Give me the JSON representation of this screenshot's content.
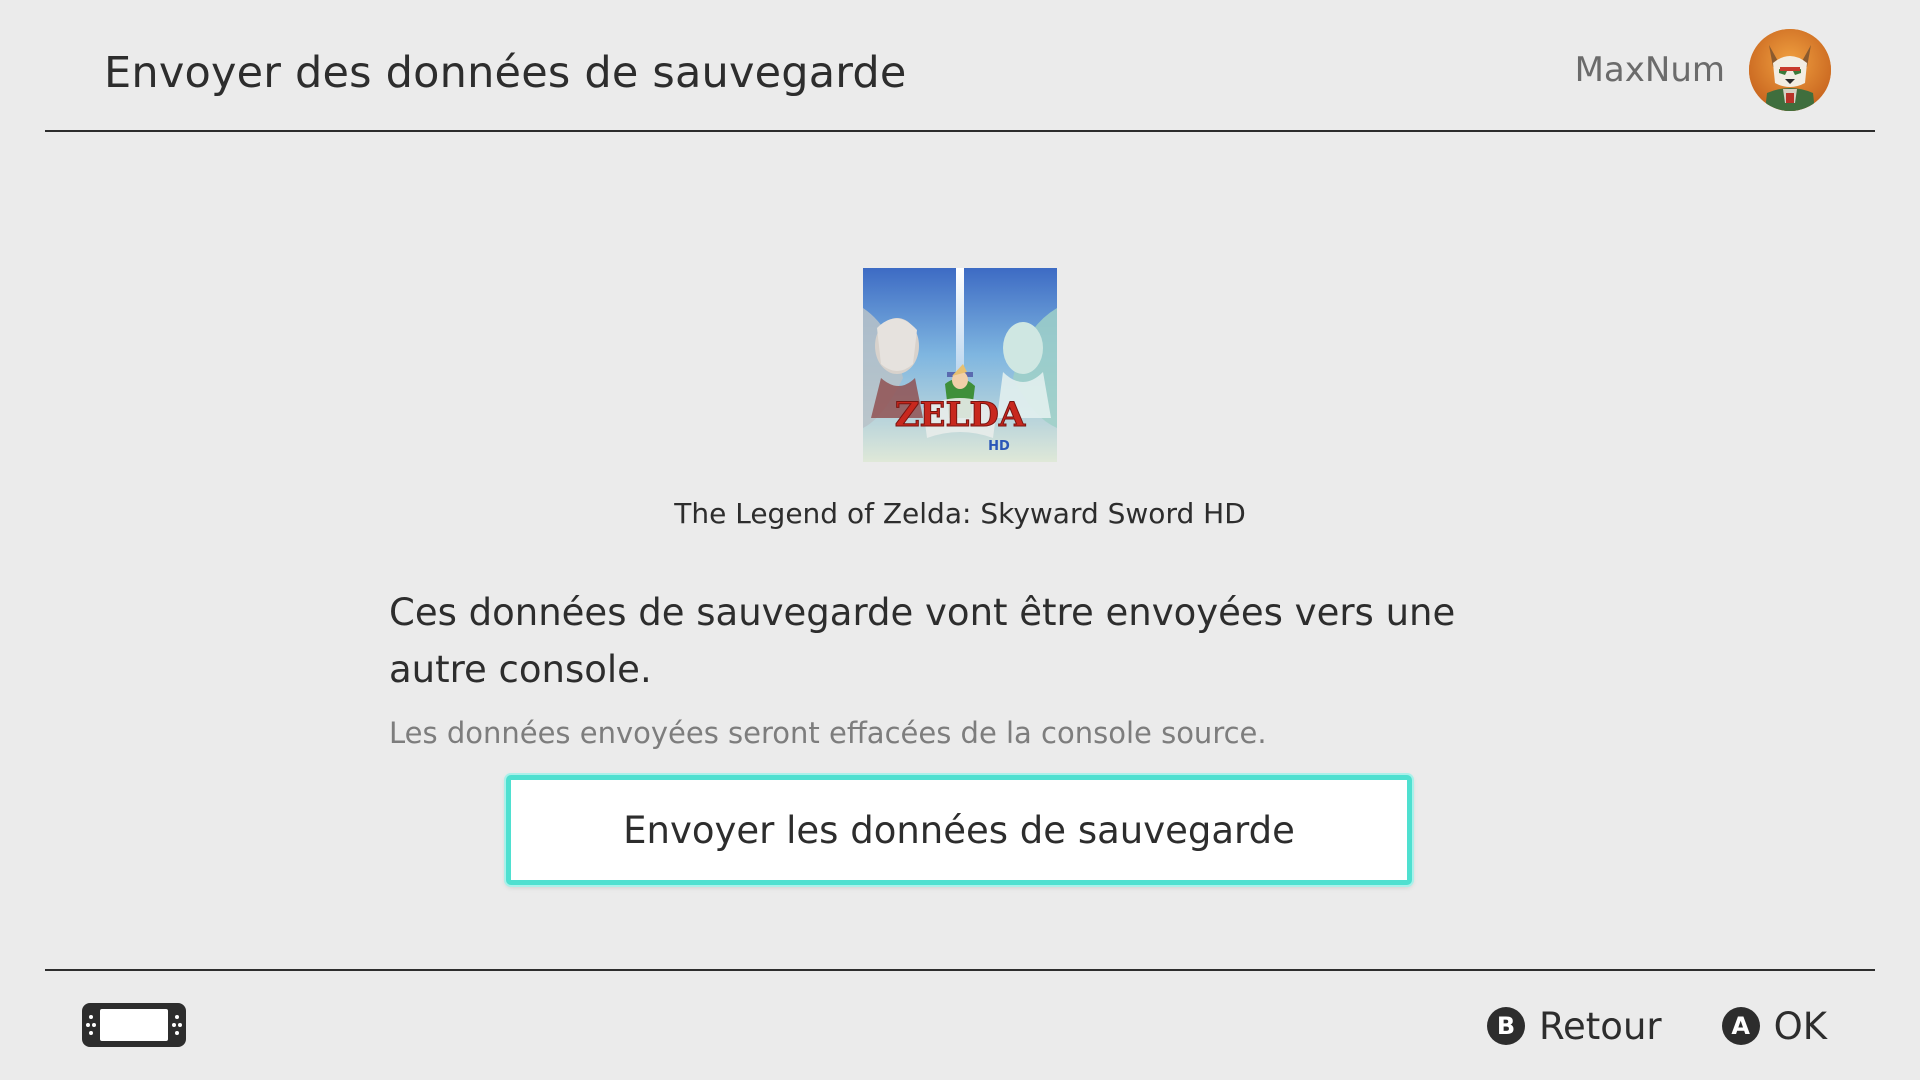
{
  "header": {
    "title": "Envoyer des données de sauvegarde",
    "username": "MaxNum",
    "avatar_icon": "fox-avatar-icon"
  },
  "game": {
    "title": "The Legend of Zelda: Skyward Sword HD",
    "cover_icon": "zelda-cover-art",
    "cover_logo_text": "ZELDA",
    "cover_logo_sub": "HD"
  },
  "main": {
    "message": "Ces données de sauvegarde vont être envoyées vers une autre console.",
    "submessage": "Les données envoyées seront effacées de la console source.",
    "send_button_label": "Envoyer les données de sauvegarde"
  },
  "footer": {
    "console_icon": "handheld-console-icon",
    "actions": [
      {
        "button": "B",
        "label": "Retour"
      },
      {
        "button": "A",
        "label": "OK"
      }
    ]
  },
  "colors": {
    "background": "#ebebeb",
    "text": "#2d2d2d",
    "muted_text": "#7d7d7d",
    "focus_accent": "#4fe0d0"
  }
}
